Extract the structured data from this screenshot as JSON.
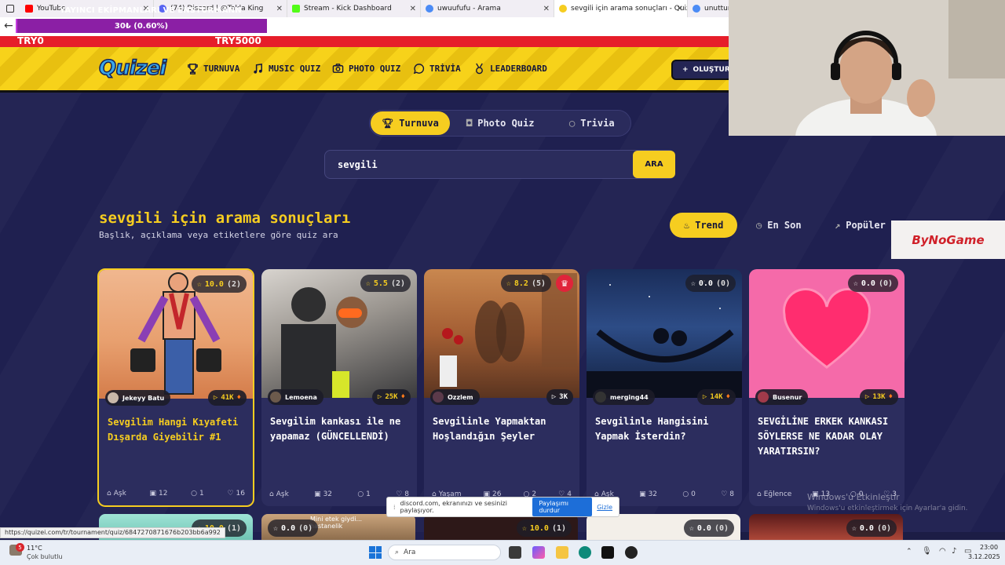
{
  "browser": {
    "tabs": [
      {
        "label": "YouTube",
        "color": "#ff0000"
      },
      {
        "label": "(74) Discord | @Takla King",
        "color": "#5865f2"
      },
      {
        "label": "Stream - Kick Dashboard",
        "color": "#53fc18"
      },
      {
        "label": "uwuufufu - Arama",
        "color": "#4b8bf5"
      },
      {
        "label": "sevgili için arama sonuçları - Quiz",
        "color": "#f6cd20"
      },
      {
        "label": "unuttunmu bebni akor",
        "color": "#4b8bf5"
      }
    ],
    "status_url": "https://quizei.com/tr/tournament/quiz/6847270871676b203bb6a992"
  },
  "overlay": {
    "title": "YAYINCI EKİPMANLARI VE ENSTÜRMANN",
    "progress_text": "30₺ (0.60%)",
    "progress_fraction": 0.006,
    "goal_start": "TRY0",
    "goal_end": "TRY5000"
  },
  "header": {
    "logo": "Quizei",
    "nav": [
      "TURNUVA",
      "MUSIC QUIZ",
      "PHOTO QUIZ",
      "TRİVİA",
      "LEADERBOARD"
    ],
    "create_label": "OLUŞTUR"
  },
  "filter_tabs": [
    "Turnuva",
    "Photo Quiz",
    "Trivia"
  ],
  "search": {
    "value": "sevgili",
    "button": "ARA"
  },
  "results": {
    "title": "sevgili için arama sonuçları",
    "subtitle": "Başlık, açıklama veya etiketlere göre quiz ara"
  },
  "sort_tabs": [
    "Trend",
    "En Son",
    "Popüler"
  ],
  "cards": [
    {
      "title": "Sevgilim Hangi Kıyafeti Dışarda Giyebilir #1",
      "rating": "10.0",
      "rating_count": "(2)",
      "author": "Jekeyy Batu",
      "views": "41K",
      "category": "Aşk",
      "items": "12",
      "comments": "1",
      "likes": "16"
    },
    {
      "title": "Sevgilim kankası ile ne yapamaz (GÜNCELLENDİ)",
      "rating": "5.5",
      "rating_count": "(2)",
      "author": "Lemoena",
      "views": "25K",
      "category": "Aşk",
      "items": "32",
      "comments": "1",
      "likes": "8"
    },
    {
      "title": "Sevgilinle Yapmaktan Hoşlandığın Şeyler",
      "rating": "8.2",
      "rating_count": "(5)",
      "author": "Ozzlem",
      "views": "3K",
      "category": "Yaşam",
      "items": "26",
      "comments": "2",
      "likes": "4"
    },
    {
      "title": "Sevgilinle Hangisini Yapmak İsterdin?",
      "rating": "0.0",
      "rating_count": "(0)",
      "author": "merging44",
      "views": "14K",
      "category": "Aşk",
      "items": "32",
      "comments": "0",
      "likes": "8"
    },
    {
      "title": "SEVGİLİNE ERKEK KANKASI SÖYLERSE NE KADAR OLAY YARATIRSIN?",
      "rating": "0.0",
      "rating_count": "(0)",
      "author": "Busenur",
      "views": "13K",
      "category": "Eğlence",
      "items": "13",
      "comments": "0",
      "likes": "3"
    }
  ],
  "bottom_ratings": [
    {
      "rating": "10.0",
      "rating_count": "(1)"
    },
    {
      "rating": "0.0",
      "rating_count": "(0)"
    },
    {
      "rating": "10.0",
      "rating_count": "(1)"
    },
    {
      "rating": "0.0",
      "rating_count": "(0)"
    },
    {
      "rating": "0.0",
      "rating_count": "(0)"
    }
  ],
  "bottom_snippet": "Mini etek giydi... hastanelik",
  "share_bar": {
    "text": "discord.com, ekranınızı ve sesinizi paylaşıyor.",
    "stop": "Paylaşımı durdur",
    "hide": "Gizle"
  },
  "sponsor": "ByNoGame",
  "windows": {
    "activate_title": "Windows'u Etkinleştir",
    "activate_sub": "Windows'u etkinleştirmek için Ayarlar'a gidin."
  },
  "taskbar": {
    "temp": "11°C",
    "weather": "Çok bulutlu",
    "search": "Ara",
    "time": "23:00",
    "date": "3.12.2025",
    "badge": "5"
  }
}
